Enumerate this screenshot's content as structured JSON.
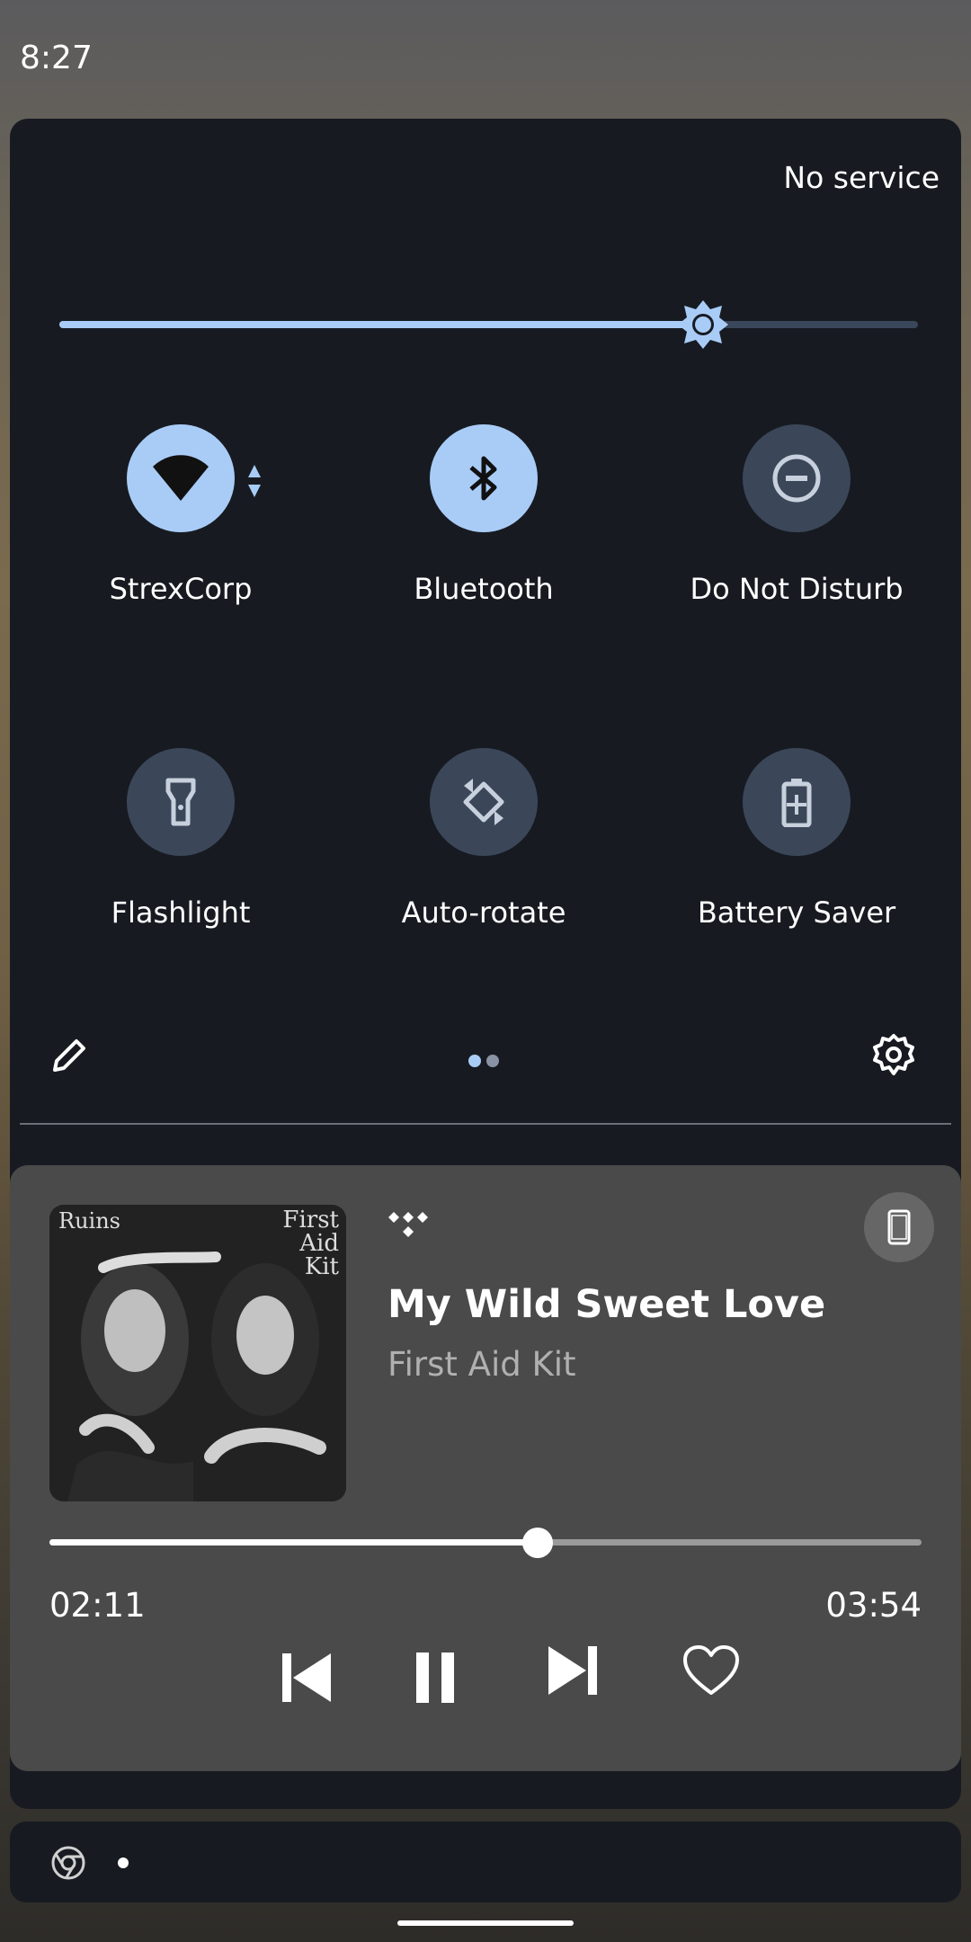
{
  "status_bar": {
    "time": "8:27"
  },
  "qs": {
    "carrier": "No service",
    "brightness_level": 0.75,
    "tiles": [
      {
        "label": "StrexCorp",
        "icon": "wifi-icon",
        "active": true
      },
      {
        "label": "Bluetooth",
        "icon": "bluetooth-icon",
        "active": true
      },
      {
        "label": "Do Not Disturb",
        "icon": "do-not-disturb-icon",
        "active": false
      },
      {
        "label": "Flashlight",
        "icon": "flashlight-icon",
        "active": false
      },
      {
        "label": "Auto-rotate",
        "icon": "auto-rotate-icon",
        "active": false
      },
      {
        "label": "Battery Saver",
        "icon": "battery-saver-icon",
        "active": false
      }
    ],
    "page_index": 1,
    "page_count": 2
  },
  "media": {
    "title": "My Wild Sweet Love",
    "artist": "First Aid Kit",
    "album_art_text_left": "Ruins",
    "album_art_text_right": "First Aid Kit",
    "elapsed": "02:11",
    "total": "03:54",
    "progress": 0.56
  },
  "colors": {
    "accent": "#a9ccf7",
    "panel": "#171b21",
    "media_card": "#4a4a4a"
  }
}
